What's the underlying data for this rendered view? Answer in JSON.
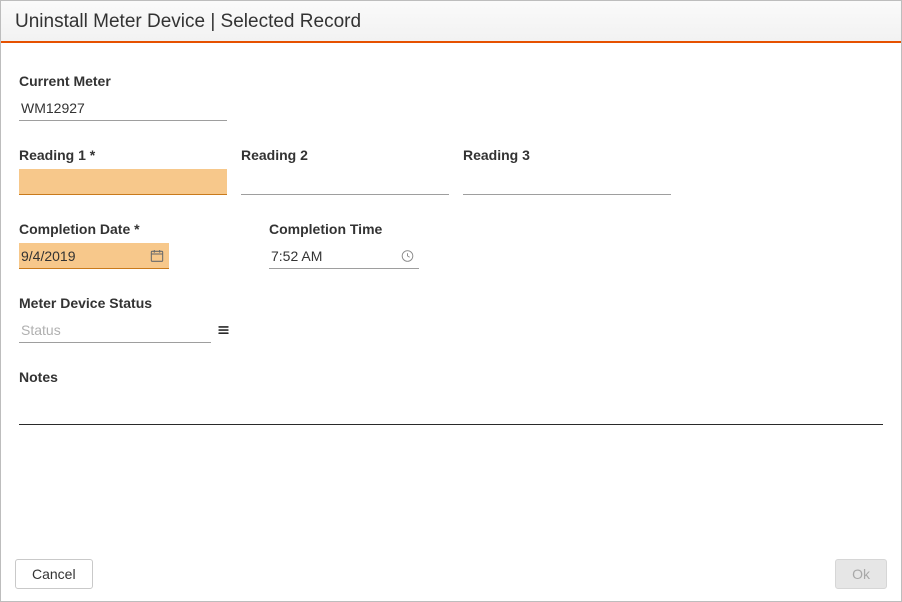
{
  "title": "Uninstall Meter Device | Selected Record",
  "fields": {
    "current_meter": {
      "label": "Current Meter",
      "value": "WM12927"
    },
    "reading1": {
      "label": "Reading 1 *",
      "value": ""
    },
    "reading2": {
      "label": "Reading 2",
      "value": ""
    },
    "reading3": {
      "label": "Reading 3",
      "value": ""
    },
    "completion_date": {
      "label": "Completion Date *",
      "value": "9/4/2019"
    },
    "completion_time": {
      "label": "Completion Time",
      "value": "7:52 AM"
    },
    "meter_status": {
      "label": "Meter Device Status",
      "value": "",
      "placeholder": "Status"
    },
    "notes": {
      "label": "Notes",
      "value": ""
    }
  },
  "buttons": {
    "cancel": "Cancel",
    "ok": "Ok"
  }
}
